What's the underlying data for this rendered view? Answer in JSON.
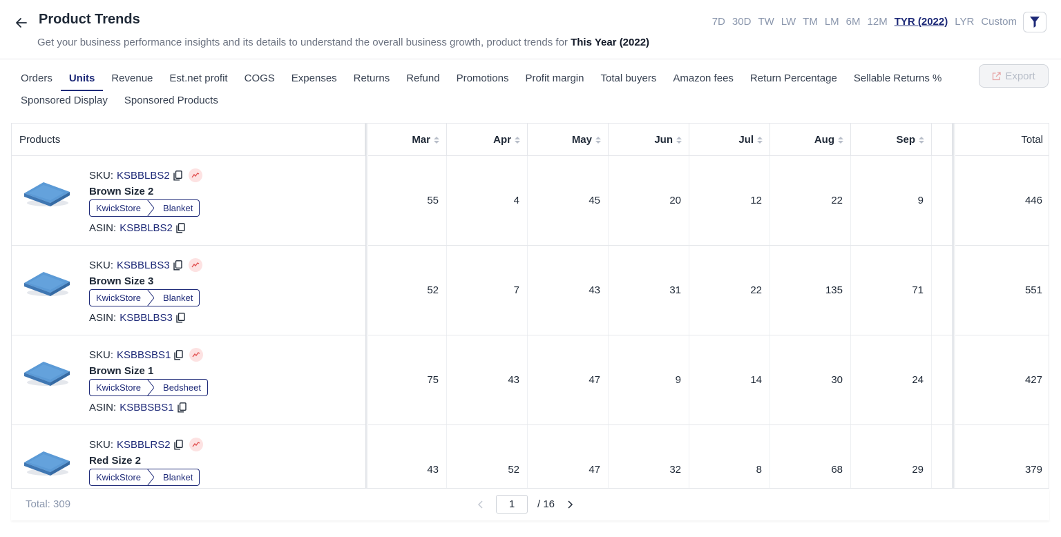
{
  "header": {
    "title": "Product Trends",
    "subtitle": "Get your business performance insights and its details to understand the overall business growth, product trends for",
    "subtitle_period": "This Year (2022)",
    "ranges": [
      "7D",
      "30D",
      "TW",
      "LW",
      "TM",
      "LM",
      "6M",
      "12M",
      "TYR (2022)",
      "LYR",
      "Custom"
    ],
    "active_range": "TYR (2022)"
  },
  "tabs": {
    "line1": [
      "Orders",
      "Units",
      "Revenue",
      "Est.net profit",
      "COGS",
      "Expenses",
      "Returns",
      "Refund",
      "Promotions",
      "Profit margin",
      "Total buyers",
      "Amazon fees",
      "Return Percentage",
      "Sellable Returns %"
    ],
    "line2": [
      "Sponsored Display",
      "Sponsored Products"
    ],
    "active": "Units",
    "export_label": "Export"
  },
  "table": {
    "products_header": "Products",
    "months": [
      "Mar",
      "Apr",
      "May",
      "Jun",
      "Jul",
      "Aug",
      "Sep"
    ],
    "total_header": "Total",
    "sku_label": "SKU:",
    "asin_label": "ASIN:",
    "rows": [
      {
        "sku": "KSBBLBS2",
        "name": "Brown Size 2",
        "store": "KwickStore",
        "category": "Blanket",
        "asin": "KSBBLBS2",
        "values": [
          "55",
          "4",
          "45",
          "20",
          "12",
          "22",
          "9"
        ],
        "total": "446"
      },
      {
        "sku": "KSBBLBS3",
        "name": "Brown Size 3",
        "store": "KwickStore",
        "category": "Blanket",
        "asin": "KSBBLBS3",
        "values": [
          "52",
          "7",
          "43",
          "31",
          "22",
          "135",
          "71"
        ],
        "total": "551"
      },
      {
        "sku": "KSBBSBS1",
        "name": "Brown Size 1",
        "store": "KwickStore",
        "category": "Bedsheet",
        "asin": "KSBBSBS1",
        "values": [
          "75",
          "43",
          "47",
          "9",
          "14",
          "30",
          "24"
        ],
        "total": "427"
      },
      {
        "sku": "KSBBLRS2",
        "name": "Red Size 2",
        "store": "KwickStore",
        "category": "Blanket",
        "asin": "",
        "values": [
          "43",
          "52",
          "47",
          "32",
          "8",
          "68",
          "29"
        ],
        "total": "379"
      }
    ]
  },
  "footer": {
    "total_text": "Total: 309",
    "current_page": "1",
    "page_total": "/ 16"
  },
  "colors": {
    "accent": "#1e2a78",
    "muted": "#8b97ad",
    "trend_bg": "#fde2e2",
    "trend_line": "#e25555",
    "product_image": "#4f8fcf"
  },
  "icons": {
    "back": "arrow-left-icon",
    "filter": "funnel-icon",
    "export": "external-link-icon",
    "copy": "copy-icon",
    "trend": "trend-line-icon"
  }
}
